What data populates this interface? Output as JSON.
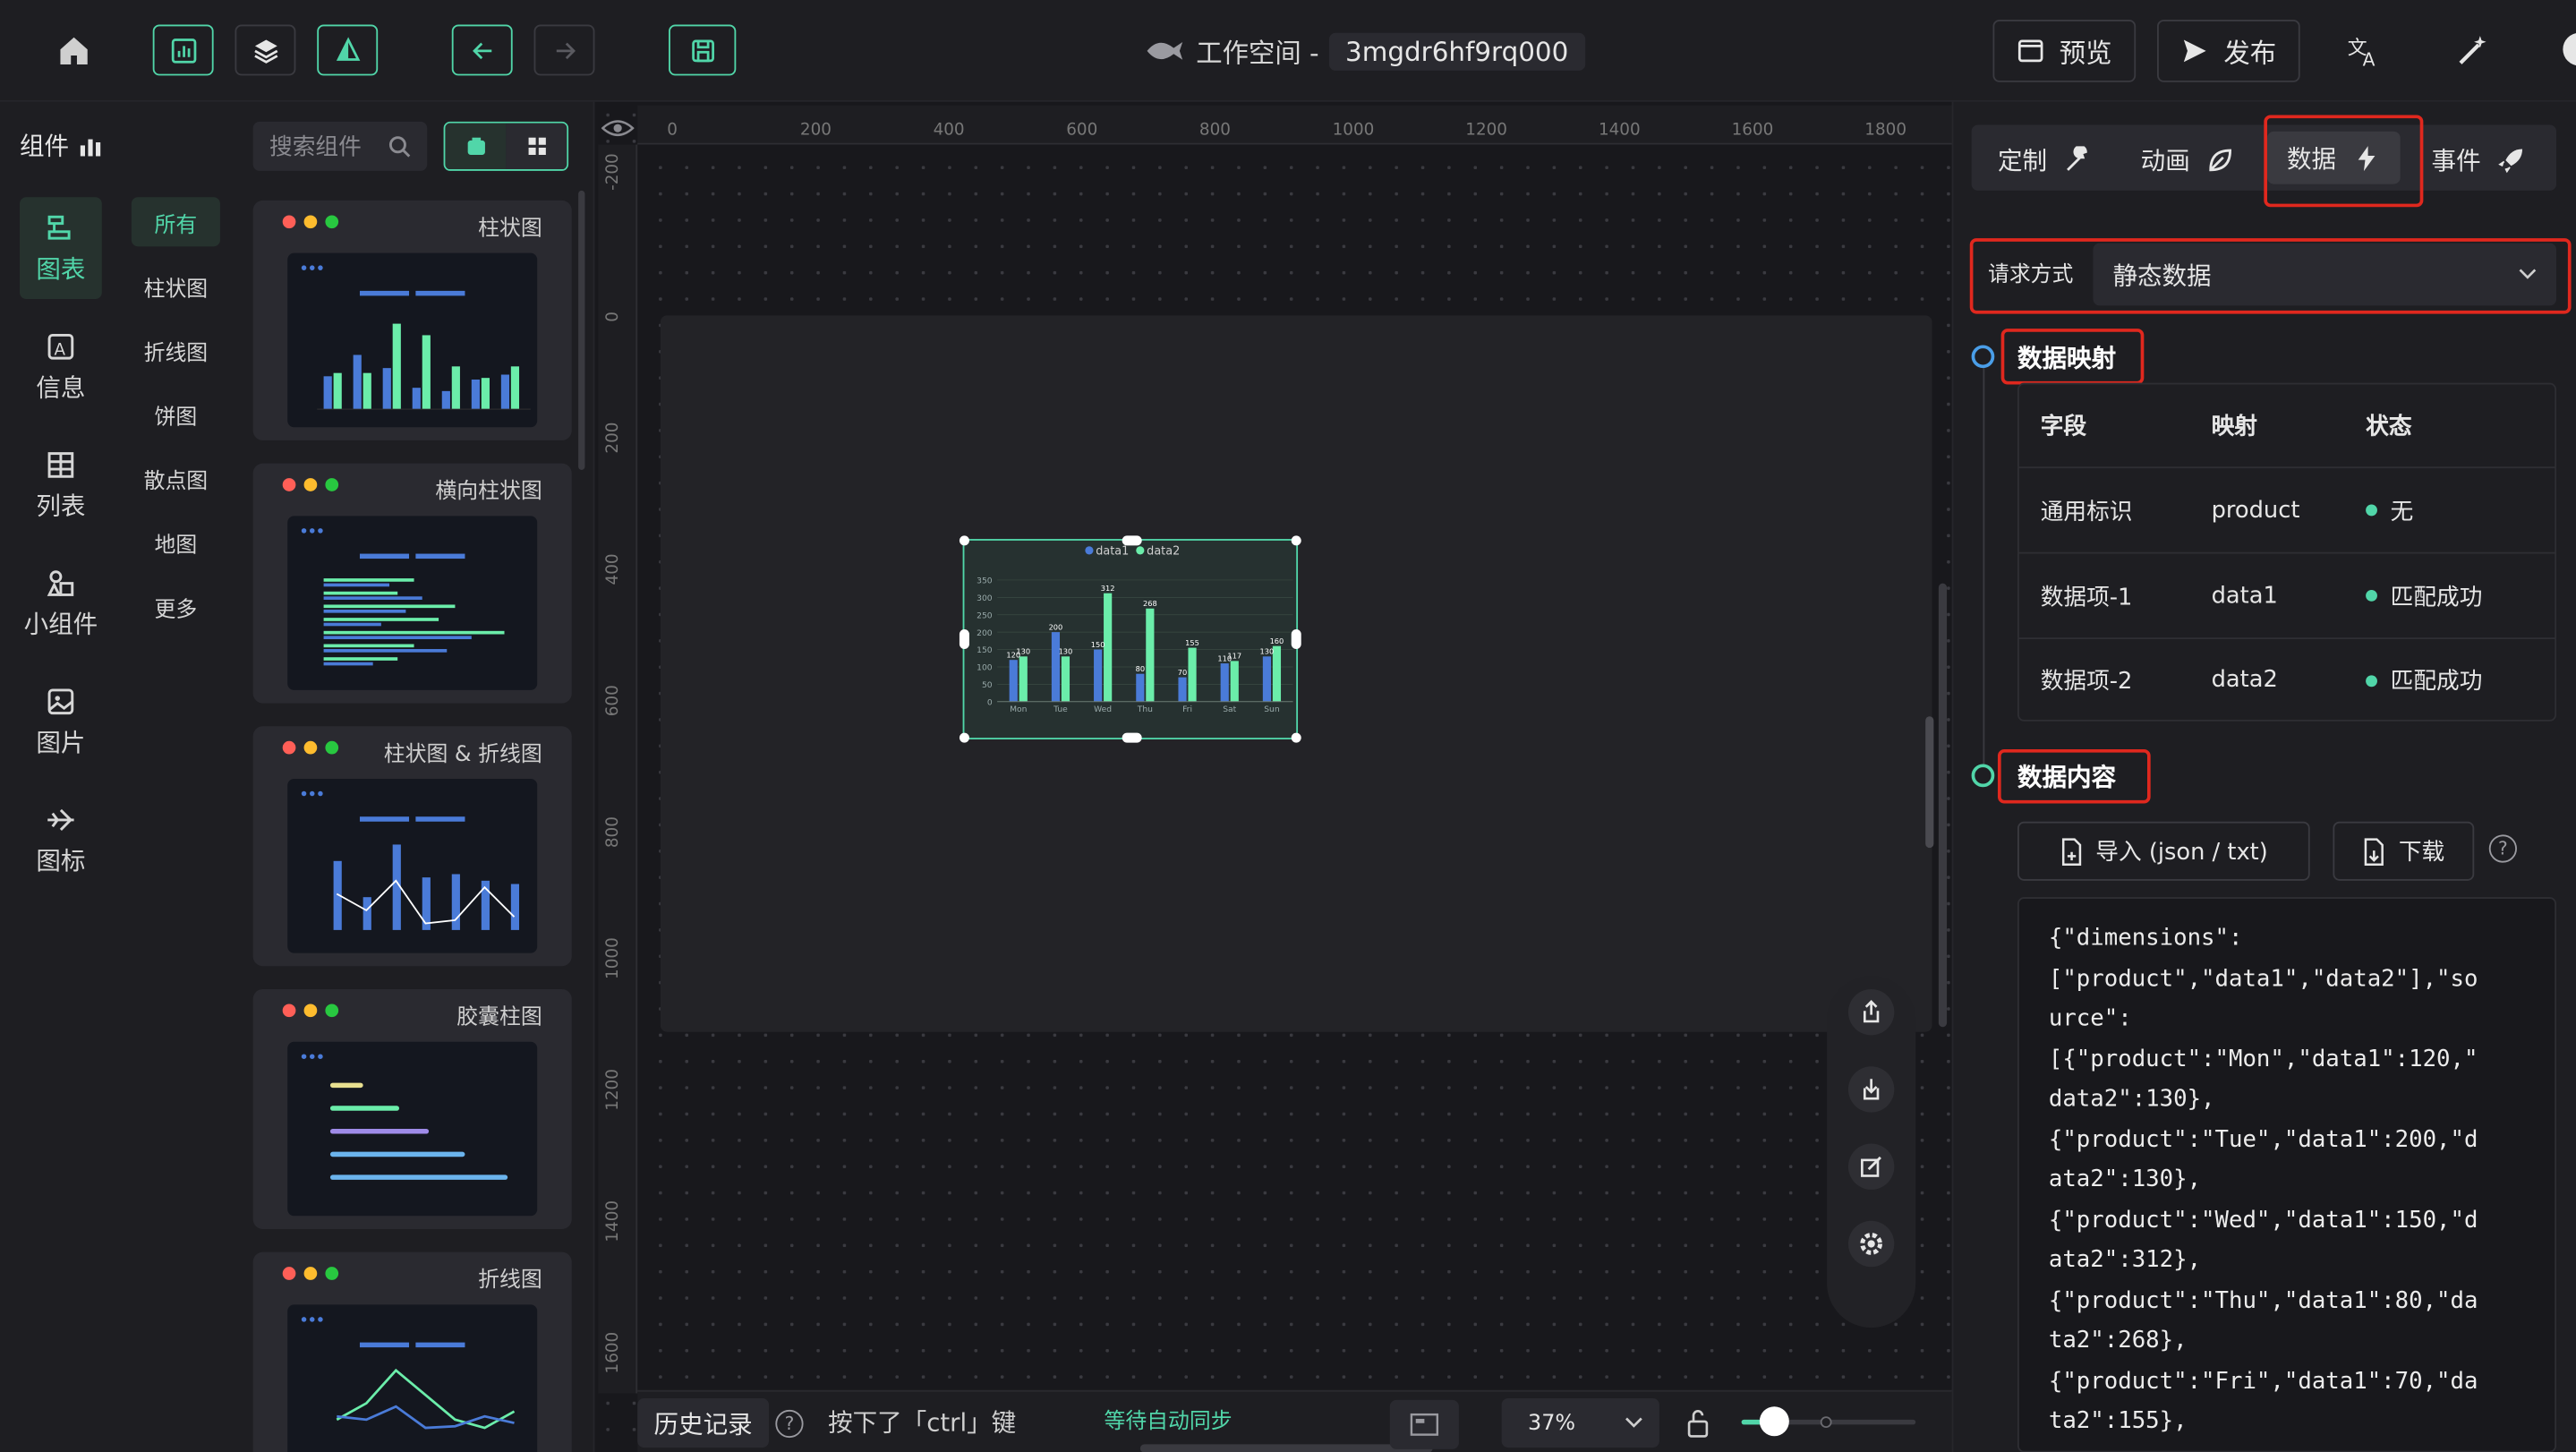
{
  "topbar": {
    "workspace_prefix": "工作空间 -",
    "workspace_id": "3mgdr6hf9rq000",
    "preview_label": "预览",
    "publish_label": "发布"
  },
  "left": {
    "header_label": "组件",
    "search_placeholder": "搜索组件",
    "categories": [
      {
        "label": "图表",
        "icon": "chart-icon"
      },
      {
        "label": "信息",
        "icon": "info-icon"
      },
      {
        "label": "列表",
        "icon": "table-icon"
      },
      {
        "label": "小组件",
        "icon": "widget-icon"
      },
      {
        "label": "图片",
        "icon": "image-icon"
      },
      {
        "label": "图标",
        "icon": "plane-icon"
      }
    ],
    "subcategories": [
      "所有",
      "柱状图",
      "折线图",
      "饼图",
      "散点图",
      "地图",
      "更多"
    ],
    "cards": [
      "柱状图",
      "横向柱状图",
      "柱状图 & 折线图",
      "胶囊柱图",
      "折线图"
    ]
  },
  "canvas": {
    "ruler_h": [
      "0",
      "200",
      "400",
      "600",
      "800",
      "1000",
      "1200",
      "1400",
      "1600",
      "1800"
    ],
    "ruler_v": [
      "-200",
      "0",
      "200",
      "400",
      "600",
      "800",
      "1000",
      "1200",
      "1400",
      "1600"
    ],
    "chart": {
      "legend": [
        "data1",
        "data2"
      ],
      "categories": [
        "Mon",
        "Tue",
        "Wed",
        "Thu",
        "Fri",
        "Sat",
        "Sun"
      ],
      "data1": [
        120,
        200,
        150,
        80,
        70,
        110,
        130
      ],
      "data2": [
        130,
        130,
        312,
        268,
        155,
        117,
        160
      ],
      "yticks": [
        "350",
        "300",
        "250",
        "200",
        "150",
        "100",
        "50",
        "0"
      ]
    }
  },
  "bottom": {
    "history_label": "历史记录",
    "hint": "按下了「ctrl」键",
    "sync": "等待自动同步",
    "zoom": "37%"
  },
  "right": {
    "tabs": [
      "定制",
      "动画",
      "数据",
      "事件"
    ],
    "request_label": "请求方式",
    "request_value": "静态数据",
    "mapping_title": "数据映射",
    "table_headers": [
      "字段",
      "映射",
      "状态"
    ],
    "rows": [
      {
        "field": "通用标识",
        "map": "product",
        "status": "无"
      },
      {
        "field": "数据项-1",
        "map": "data1",
        "status": "匹配成功"
      },
      {
        "field": "数据项-2",
        "map": "data2",
        "status": "匹配成功"
      }
    ],
    "content_title": "数据内容",
    "import_label": "导入 (json / txt)",
    "download_label": "下载",
    "json_lines": [
      "{\"dimensions\":",
      "[\"product\",\"data1\",\"data2\"],\"so",
      "urce\":",
      "[{\"product\":\"Mon\",\"data1\":120,\"",
      "data2\":130},",
      "{\"product\":\"Tue\",\"data1\":200,\"d",
      "ata2\":130},",
      "{\"product\":\"Wed\",\"data1\":150,\"d",
      "ata2\":312},",
      "{\"product\":\"Thu\",\"data1\":80,\"da",
      "ta2\":268},",
      "{\"product\":\"Fri\",\"data1\":70,\"da",
      "ta2\":155},"
    ]
  },
  "colors": {
    "accent": "#51d6a9",
    "bar1": "#4a7bd8",
    "bar2": "#6bedaa",
    "highlight": "#e0281e"
  }
}
